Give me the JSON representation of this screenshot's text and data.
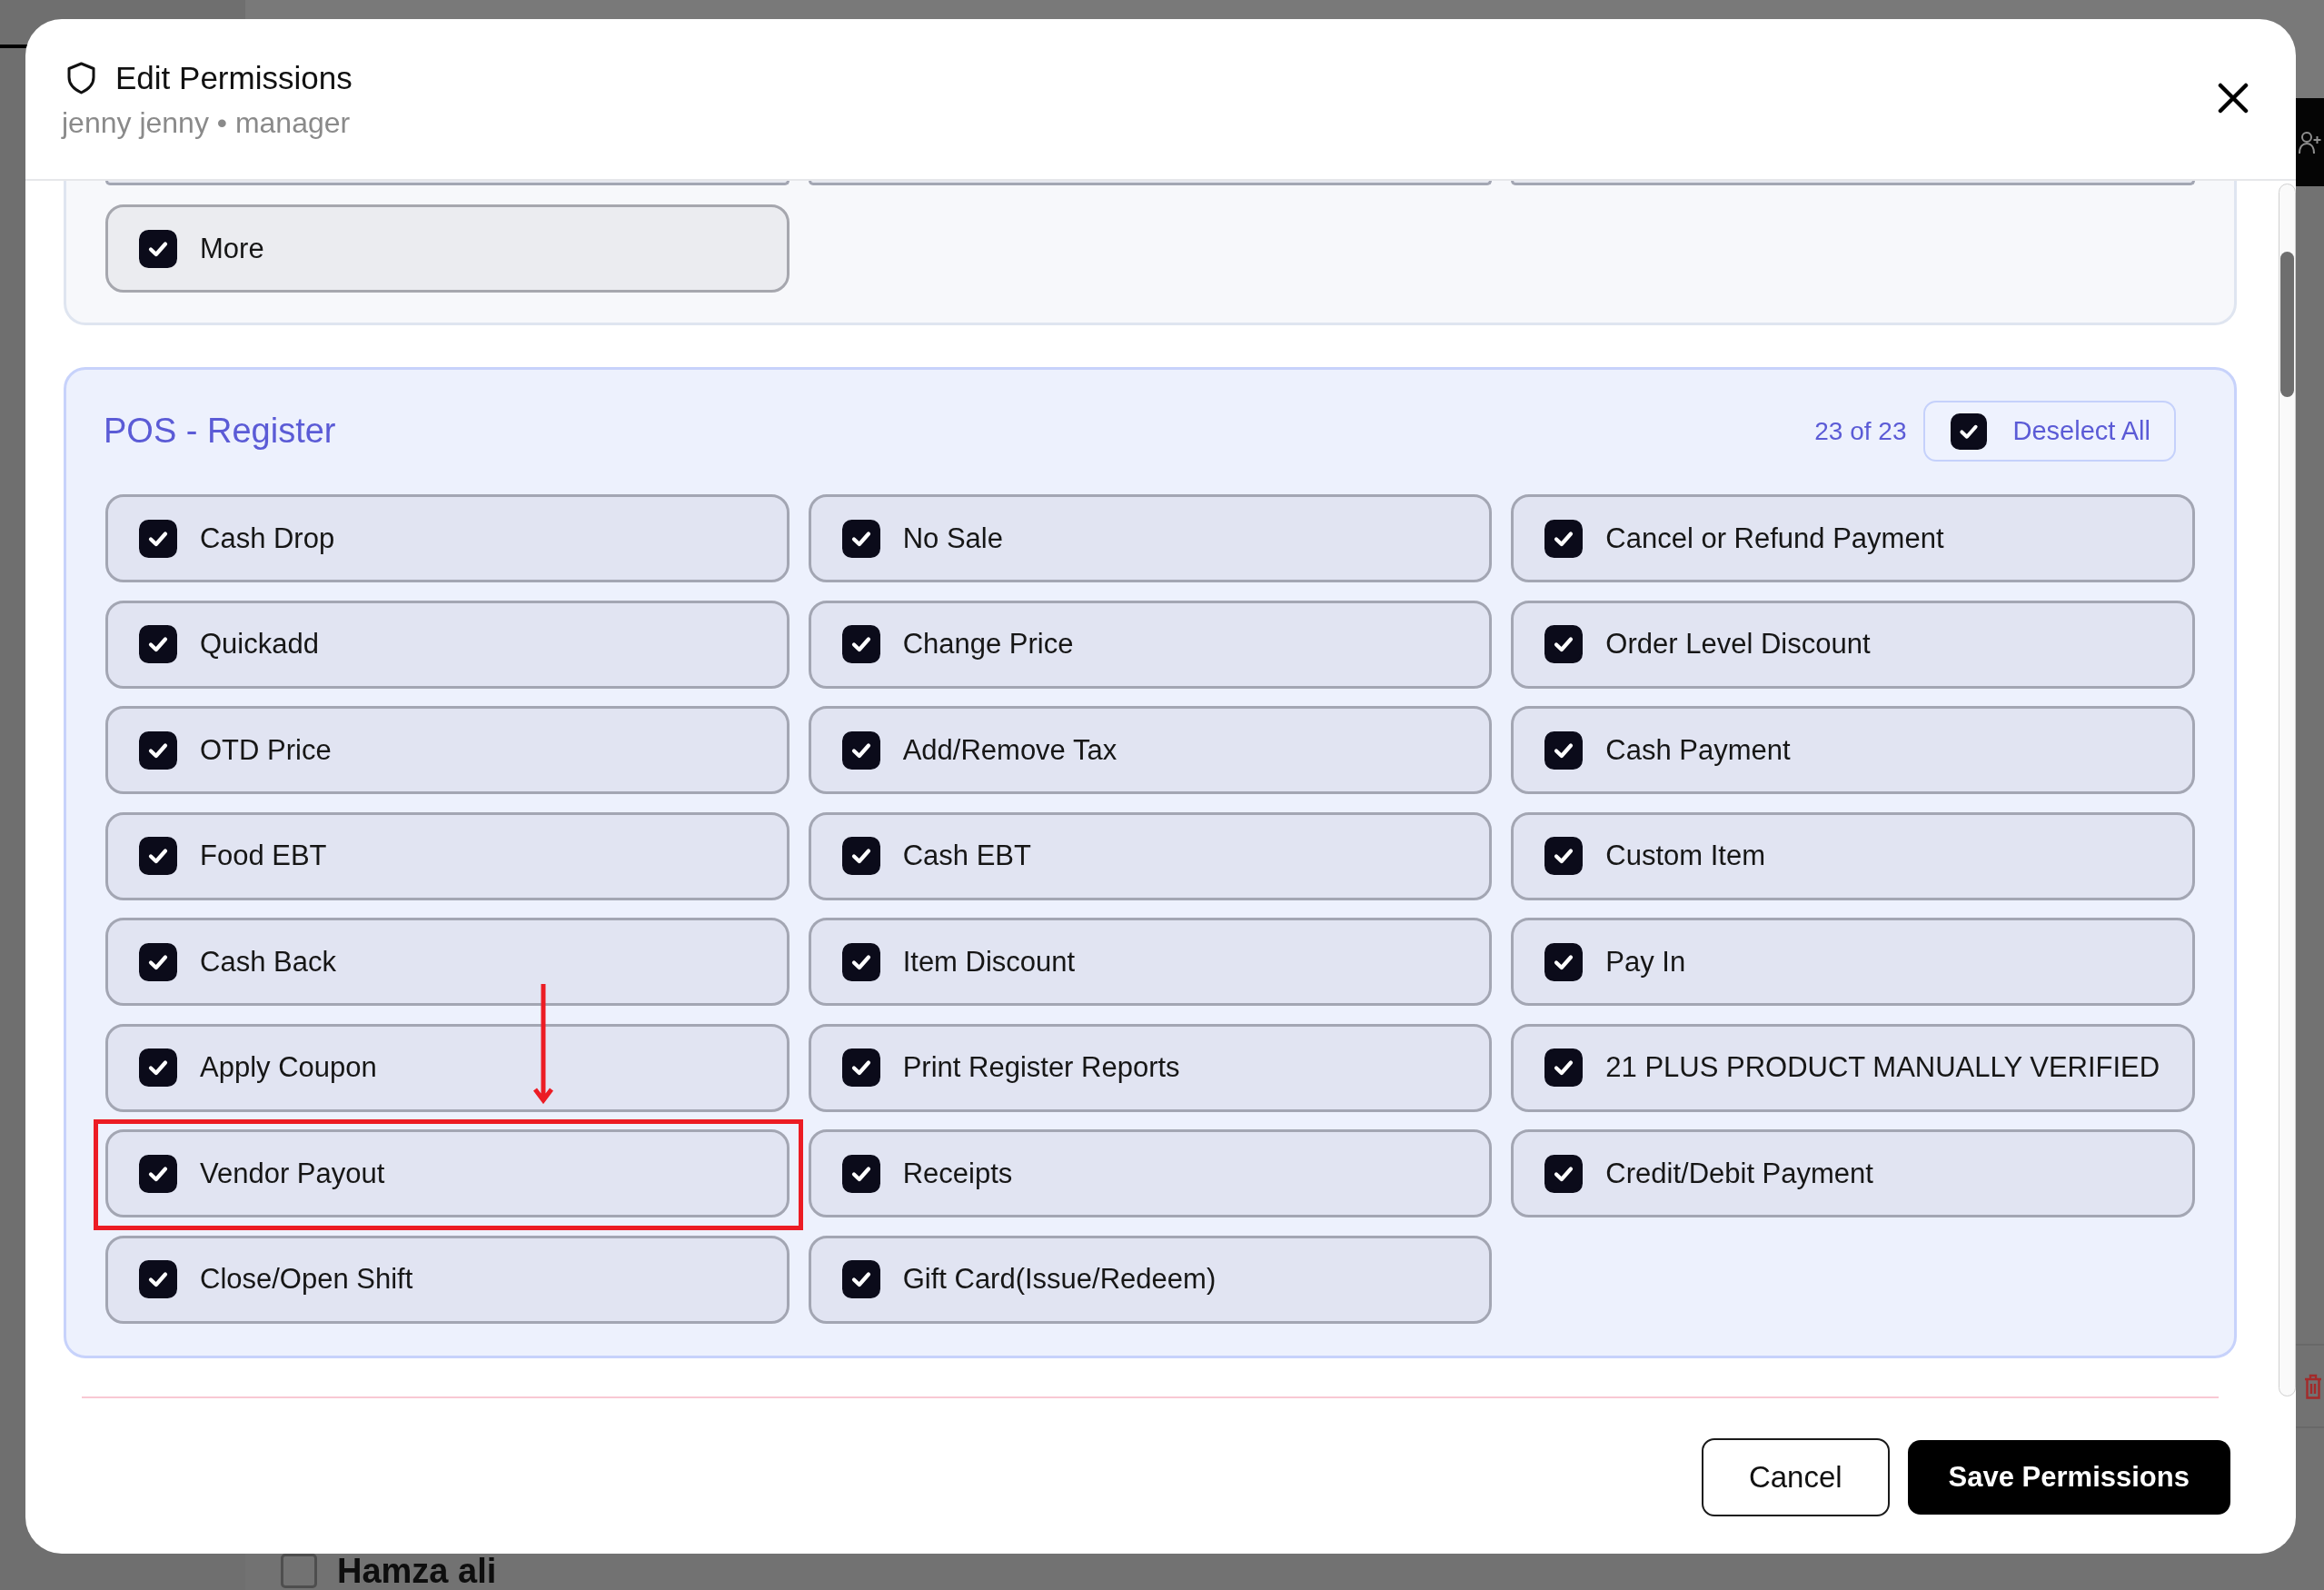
{
  "modal": {
    "title": "Edit Permissions",
    "subtitle": "jenny jenny • manager"
  },
  "sections": [
    {
      "items": [
        {
          "label": "More",
          "checked": true,
          "highlighted": false
        }
      ]
    },
    {
      "title": "POS - Register",
      "count": "23 of 23",
      "toggle_all": {
        "label": "Deselect All",
        "checked": true
      },
      "items": [
        {
          "label": "Cash Drop",
          "checked": true,
          "highlighted": false
        },
        {
          "label": "No Sale",
          "checked": true,
          "highlighted": false
        },
        {
          "label": "Cancel or Refund Payment",
          "checked": true,
          "highlighted": false
        },
        {
          "label": "Quickadd",
          "checked": true,
          "highlighted": false
        },
        {
          "label": "Change Price",
          "checked": true,
          "highlighted": false
        },
        {
          "label": "Order Level Discount",
          "checked": true,
          "highlighted": false
        },
        {
          "label": "OTD Price",
          "checked": true,
          "highlighted": false
        },
        {
          "label": "Add/Remove Tax",
          "checked": true,
          "highlighted": false
        },
        {
          "label": "Cash Payment",
          "checked": true,
          "highlighted": false
        },
        {
          "label": "Food EBT",
          "checked": true,
          "highlighted": false
        },
        {
          "label": "Cash EBT",
          "checked": true,
          "highlighted": false
        },
        {
          "label": "Custom Item",
          "checked": true,
          "highlighted": false
        },
        {
          "label": "Cash Back",
          "checked": true,
          "highlighted": false
        },
        {
          "label": "Item Discount",
          "checked": true,
          "highlighted": false
        },
        {
          "label": "Pay In",
          "checked": true,
          "highlighted": false
        },
        {
          "label": "Apply Coupon",
          "checked": true,
          "highlighted": false
        },
        {
          "label": "Print Register Reports",
          "checked": true,
          "highlighted": false
        },
        {
          "label": "21 PLUS PRODUCT MANUALLY VERIFIED",
          "checked": true,
          "highlighted": false
        },
        {
          "label": "Vendor Payout",
          "checked": true,
          "highlighted": true
        },
        {
          "label": "Receipts",
          "checked": true,
          "highlighted": false
        },
        {
          "label": "Credit/Debit Payment",
          "checked": true,
          "highlighted": false
        },
        {
          "label": "Close/Open Shift",
          "checked": true,
          "highlighted": false
        },
        {
          "label": "Gift Card(Issue/Redeem)",
          "checked": true,
          "highlighted": false
        }
      ]
    }
  ],
  "buttons": [
    {
      "label": "Cancel",
      "kind": "secondary"
    },
    {
      "label": "Save Permissions",
      "kind": "primary"
    }
  ],
  "background": {
    "rows": [
      {
        "name": "Hamza ali",
        "checked": false
      }
    ]
  }
}
